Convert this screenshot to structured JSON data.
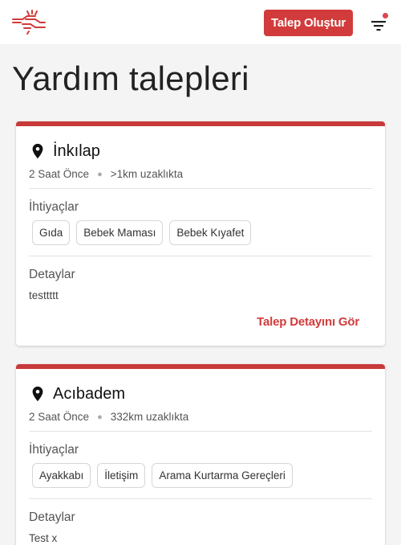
{
  "header": {
    "create_button": "Talep Oluştur",
    "logo_icon": "helping-hands-logo",
    "filter_icon": "filter-icon",
    "accent_color": "#d23b3b"
  },
  "page": {
    "title": "Yardım talepleri"
  },
  "requests": [
    {
      "place": "İnkılap",
      "time": "2 Saat Önce",
      "distance": ">1km uzaklıkta",
      "needs_label": "İhtiyaçlar",
      "needs": [
        "Gıda",
        "Bebek Maması",
        "Bebek Kıyafet"
      ],
      "details_label": "Detaylar",
      "details": "testtttt",
      "detail_link": "Talep Detayını Gör"
    },
    {
      "place": "Acıbadem",
      "time": "2 Saat Önce",
      "distance": "332km uzaklıkta",
      "needs_label": "İhtiyaçlar",
      "needs": [
        "Ayakkabı",
        "İletişim",
        "Arama Kurtarma Gereçleri"
      ],
      "details_label": "Detaylar",
      "details": "Test x"
    }
  ]
}
